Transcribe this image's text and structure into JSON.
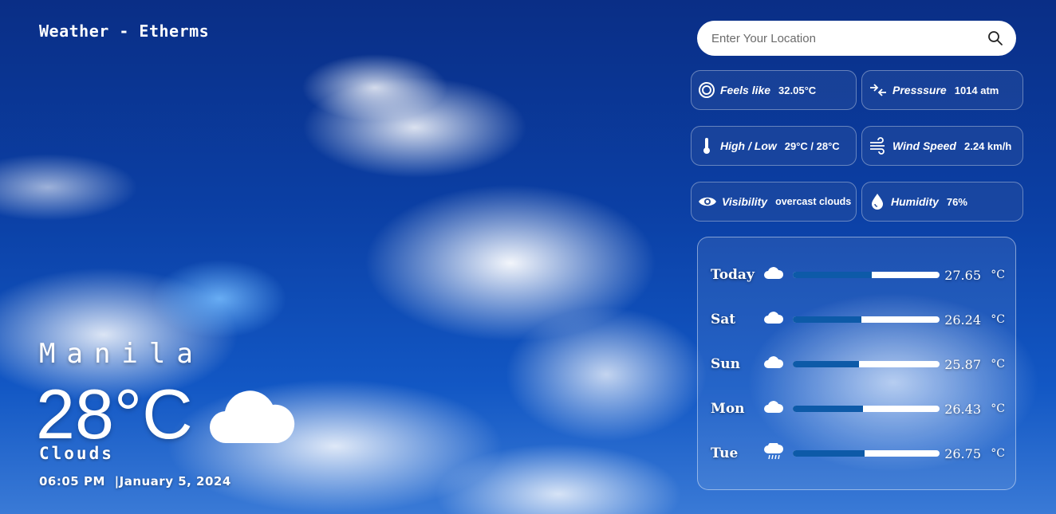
{
  "app": {
    "title": "Weather - Etherms"
  },
  "search": {
    "placeholder": "Enter Your Location",
    "value": "",
    "icon": "search-icon"
  },
  "details": {
    "feels_like": {
      "label": "Feels like",
      "value": "32.05°C",
      "icon": "ring-icon"
    },
    "pressure": {
      "label": "Presssure",
      "value": "1014 atm",
      "icon": "pressure-arrows-icon"
    },
    "high_low": {
      "label": "High / Low",
      "value": "29°C / 28°C",
      "icon": "thermometer-icon"
    },
    "wind_speed": {
      "label": "Wind Speed",
      "value": "2.24 km/h",
      "icon": "wind-icon"
    },
    "visibility": {
      "label": "Visibility",
      "value": "overcast clouds",
      "icon": "eye-icon"
    },
    "humidity": {
      "label": "Humidity",
      "value": "76%",
      "icon": "droplet-icon"
    }
  },
  "forecast": [
    {
      "day": "Today",
      "temp": "27.65",
      "unit": "°C",
      "icon": "cloud-icon",
      "level": 0.54
    },
    {
      "day": "Sat",
      "temp": "26.24",
      "unit": "°C",
      "icon": "cloud-icon",
      "level": 0.47
    },
    {
      "day": "Sun",
      "temp": "25.87",
      "unit": "°C",
      "icon": "cloud-icon",
      "level": 0.45
    },
    {
      "day": "Mon",
      "temp": "26.43",
      "unit": "°C",
      "icon": "cloud-icon",
      "level": 0.48
    },
    {
      "day": "Tue",
      "temp": "26.75",
      "unit": "°C",
      "icon": "rain-cloud-icon",
      "level": 0.49
    }
  ],
  "current": {
    "city": "Manila",
    "temperature": "28°C",
    "description": "Clouds",
    "icon": "cloud-icon",
    "time": "06:05 PM",
    "separator": "|",
    "date": "January 5, 2024"
  },
  "colors": {
    "bar_fill": "#0d5aa8",
    "bar_track": "#ffffff",
    "sky": "#0b3fa4"
  }
}
